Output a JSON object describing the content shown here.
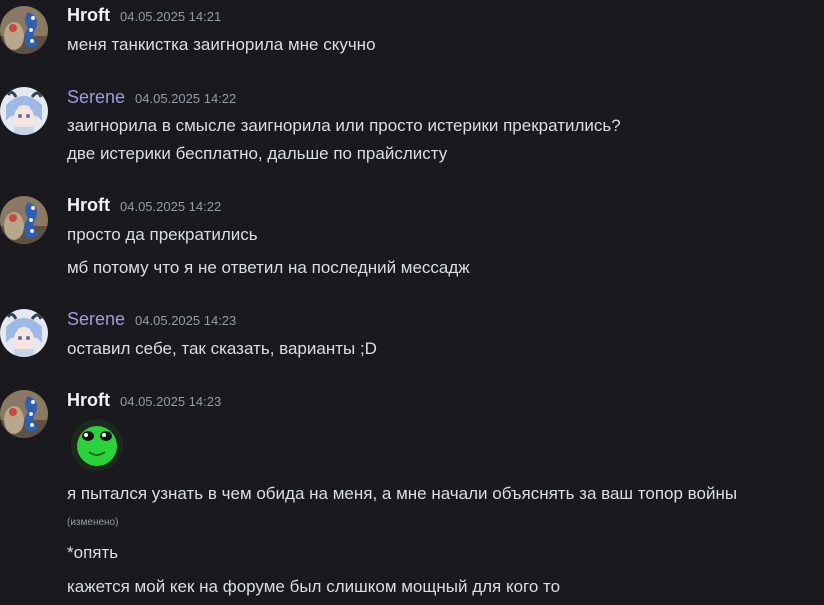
{
  "messages": [
    {
      "author": "Hroft",
      "timestamp": "04.05.2025 14:21",
      "lines": [
        "меня танкистка заигнорила мне скучно"
      ]
    },
    {
      "author": "Serene",
      "timestamp": "04.05.2025 14:22",
      "lines": [
        "заигнорила в смысле заигнорила или просто истерики прекратились?",
        "две истерики бесплатно, дальше по прайслисту"
      ]
    },
    {
      "author": "Hroft",
      "timestamp": "04.05.2025 14:22",
      "lines": [
        "просто да прекратились",
        "мб потому что я не ответил на последний мессадж"
      ]
    },
    {
      "author": "Serene",
      "timestamp": "04.05.2025 14:23",
      "lines": [
        "оставил себе, так сказать, варианты ;D"
      ]
    },
    {
      "author": "Hroft",
      "timestamp": "04.05.2025 14:23",
      "emoji": "green-face-emoji",
      "lines": [
        "я пытался узнать в чем обида на меня, а мне начали объяснять за ваш топор войны",
        "*опять",
        "кажется мой кек на форуме был слишком мощный для кого то"
      ],
      "edited_label": "(изменено)"
    }
  ],
  "colors": {
    "background": "#1a1a1e",
    "hroft_name": "#f2f3f5",
    "serene_name": "#a09bdc",
    "text": "#dbdee1",
    "muted": "#949ba4"
  }
}
